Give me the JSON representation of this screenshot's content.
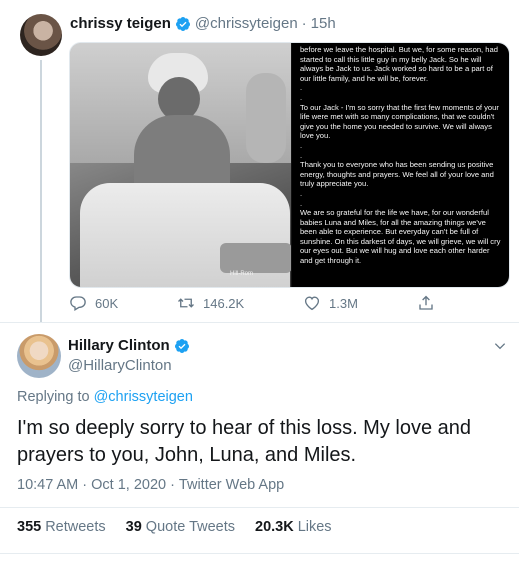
{
  "parent_tweet": {
    "author_name": "chrissy teigen",
    "handle": "@chrissyteigen",
    "separator": "·",
    "time": "15h",
    "photo_brand": "Hill-Rom",
    "notes_paragraphs": [
      "before we leave the hospital.  But we, for some reason, had started to call this little guy in my belly Jack.  So he will always be Jack to us.  Jack worked so hard to be a part of our little family, and he will be, forever.",
      ".",
      ".",
      "To our Jack - I'm so sorry that the first few moments of your life were met with so many complications, that we couldn't give you the home you needed to survive.  We will always love you.",
      ".",
      ".",
      "Thank you to everyone who has been sending us positive energy, thoughts and prayers.  We feel all of your love and truly appreciate you.",
      ".",
      ".",
      "We are so grateful for the life we have, for our wonderful babies Luna and Miles, for all the amazing things we've been able to experience.  But everyday can't be full of sunshine.  On this darkest of days, we will grieve, we will cry our eyes out.  But we will hug and love each other harder and get through it."
    ],
    "actions": {
      "replies": "60K",
      "retweets": "146.2K",
      "likes": "1.3M"
    }
  },
  "reply_tweet": {
    "author_name": "Hillary Clinton",
    "handle": "@HillaryClinton",
    "replying_prefix": "Replying to",
    "replying_to": "@chrissyteigen",
    "text": "I'm so deeply sorry to hear of this loss. My love and prayers to you, John, Luna, and Miles.",
    "time": "10:47 AM",
    "date": "Oct 1, 2020",
    "source": "Twitter Web App",
    "separator": "·",
    "stats": {
      "retweets_count": "355",
      "retweets_label": "Retweets",
      "quotes_count": "39",
      "quotes_label": "Quote Tweets",
      "likes_count": "20.3K",
      "likes_label": "Likes"
    }
  },
  "colors": {
    "text_primary": "#14171a",
    "text_secondary": "#657786",
    "link": "#1da1f2",
    "verified": "#1da1f2",
    "divider": "#e6ecf0",
    "notes_bg": "#000000"
  },
  "icons": [
    "verified-badge-icon",
    "reply-icon",
    "retweet-icon",
    "like-icon",
    "share-icon",
    "chevron-down-icon"
  ]
}
